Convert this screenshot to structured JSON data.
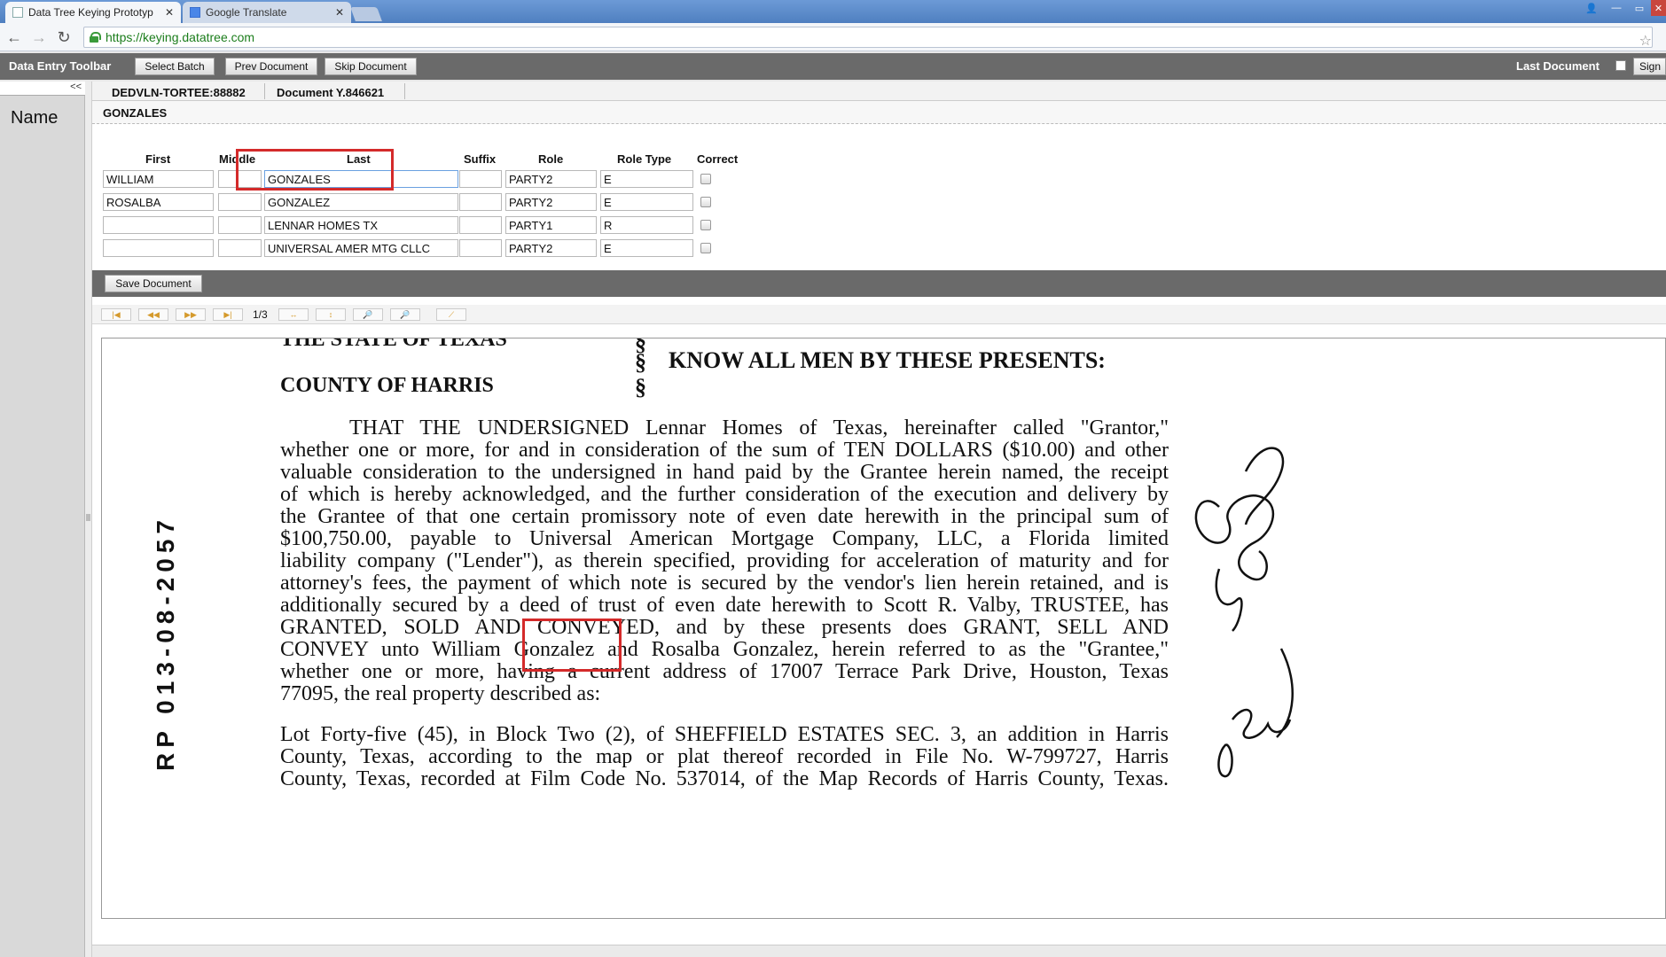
{
  "browser": {
    "tabs": [
      {
        "title": "Data Tree Keying Prototyp",
        "close": "✕"
      },
      {
        "title": "Google Translate",
        "close": "✕"
      }
    ],
    "url": "https://keying.datatree.com"
  },
  "toolbar": {
    "title": "Data Entry Toolbar",
    "select_batch": "Select Batch",
    "prev_document": "Prev Document",
    "skip_document": "Skip Document",
    "last_document": "Last Document",
    "sign": "Sign"
  },
  "left_panel": {
    "collapse": "<<",
    "title": "Name"
  },
  "document_info": {
    "batch_id": "DEDVLN-TORTEE:88882",
    "document_id": "Document Y.846621"
  },
  "current_name": "GONZALES",
  "grid": {
    "headers": {
      "first": "First",
      "middle": "Middle",
      "last": "Last",
      "suffix": "Suffix",
      "role": "Role",
      "role_type": "Role Type",
      "correct": "Correct"
    },
    "rows": [
      {
        "first": "WILLIAM",
        "middle": "",
        "last": "GONZALES",
        "suffix": "",
        "role": "PARTY2",
        "role_type": "E",
        "correct": false
      },
      {
        "first": "ROSALBA",
        "middle": "",
        "last": "GONZALEZ",
        "suffix": "",
        "role": "PARTY2",
        "role_type": "E",
        "correct": false
      },
      {
        "first": "",
        "middle": "",
        "last": "LENNAR HOMES TX",
        "suffix": "",
        "role": "PARTY1",
        "role_type": "R",
        "correct": false
      },
      {
        "first": "",
        "middle": "",
        "last": "UNIVERSAL AMER MTG CLLC",
        "suffix": "",
        "role": "PARTY2",
        "role_type": "E",
        "correct": false
      }
    ]
  },
  "save_button": "Save Document",
  "viewer": {
    "first": "|◀",
    "prev": "◀◀",
    "next": "▶▶",
    "last": "▶|",
    "page": "1/3",
    "fit_width": "↔",
    "fit_height": "↕",
    "zoom_in": "🔎",
    "zoom_out": "🔎",
    "rotate": "⟋"
  },
  "document": {
    "state_line": "THE STATE OF TEXAS",
    "section_symbol": "§",
    "know_all": "KNOW ALL MEN BY THESE PRESENTS:",
    "county_line": "COUNTY OF HARRIS",
    "paragraph1": [
      "THAT THE UNDERSIGNED Lennar Homes of Texas, hereinafter called \"Grantor,\"",
      "whether one or more, for and in consideration of the sum of TEN DOLLARS ($10.00) and other",
      "valuable consideration to the undersigned in hand paid by the Grantee herein named, the receipt",
      "of which is hereby acknowledged, and the further consideration of the execution and delivery by",
      "the Grantee of that one certain promissory note of even date herewith in the principal sum of",
      "$100,750.00, payable to Universal American Mortgage Company, LLC, a Florida limited",
      "liability company (\"Lender\"), as therein specified, providing for acceleration of maturity and for",
      "attorney's fees, the payment of which note is secured by the vendor's lien herein retained, and is",
      "additionally secured by a deed of trust of even date herewith to Scott R. Valby, TRUSTEE, has",
      "GRANTED, SOLD AND CONVEYED, and by these presents does GRANT, SELL AND",
      "CONVEY unto William Gonzalez and Rosalba Gonzalez, herein referred to as the \"Grantee,\"",
      "whether one or more, having a current address of 17007 Terrace Park Drive, Houston, Texas",
      "77095, the real property described as:"
    ],
    "paragraph2": [
      "Lot Forty-five (45), in Block Two (2), of SHEFFIELD ESTATES SEC. 3, an addition in Harris",
      "County, Texas, according to the map or plat thereof recorded in File No. W-799727, Harris",
      "County, Texas, recorded at Film Code No. 537014, of the Map Records of Harris County, Texas."
    ],
    "margin_stamp": "RP 013-08-2057"
  },
  "colors": {
    "toolbar_bg": "#6a6a6a",
    "highlight": "#d42a2a",
    "secure_url": "#1b7d1b"
  }
}
